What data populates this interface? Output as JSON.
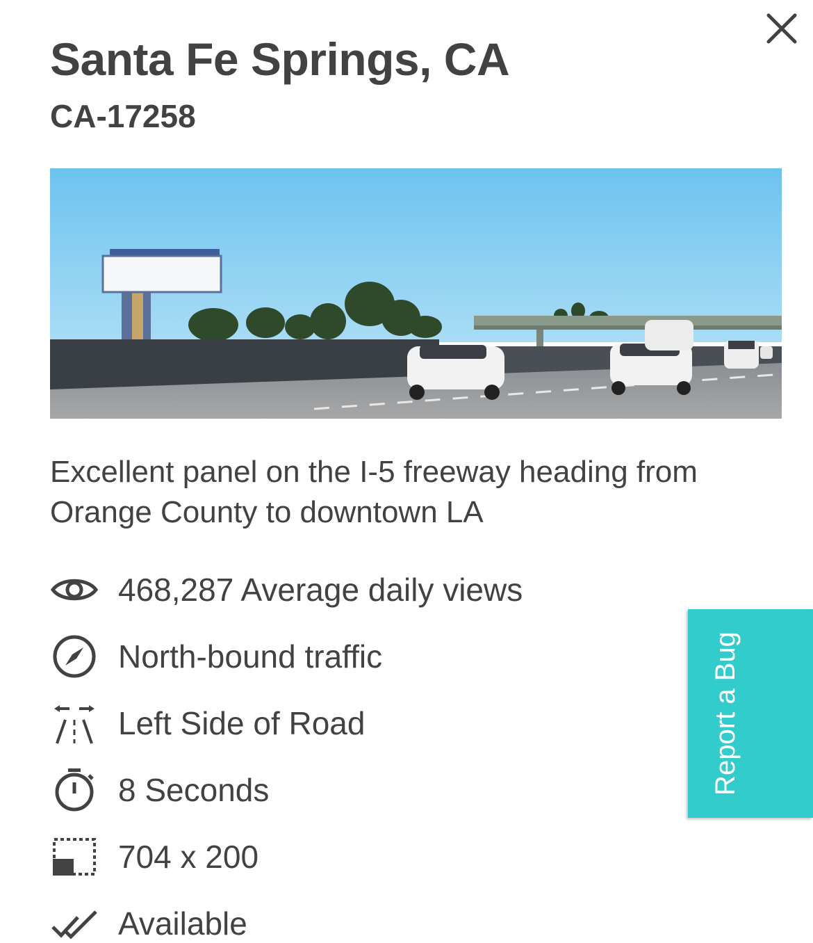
{
  "panel": {
    "title": "Santa Fe Springs, CA",
    "panel_id": "CA-17258",
    "description": "Excellent panel on the I-5 freeway heading from Orange County to downtown LA",
    "photo_icon": "billboard-freeway-photo",
    "close_icon": "close-icon"
  },
  "stats": [
    {
      "icon": "eye-icon",
      "text": "468,287 Average daily views"
    },
    {
      "icon": "compass-icon",
      "text": "North-bound traffic"
    },
    {
      "icon": "road-side-icon",
      "text": "Left Side of Road"
    },
    {
      "icon": "stopwatch-icon",
      "text": "8 Seconds"
    },
    {
      "icon": "dimensions-icon",
      "text": "704 x 200"
    },
    {
      "icon": "double-check-icon",
      "text": "Available"
    }
  ],
  "report_bug": {
    "label": "Report a Bug",
    "color": "#33cccc"
  },
  "colors": {
    "text": "#424242",
    "accent": "#33cccc",
    "background": "#ffffff"
  }
}
